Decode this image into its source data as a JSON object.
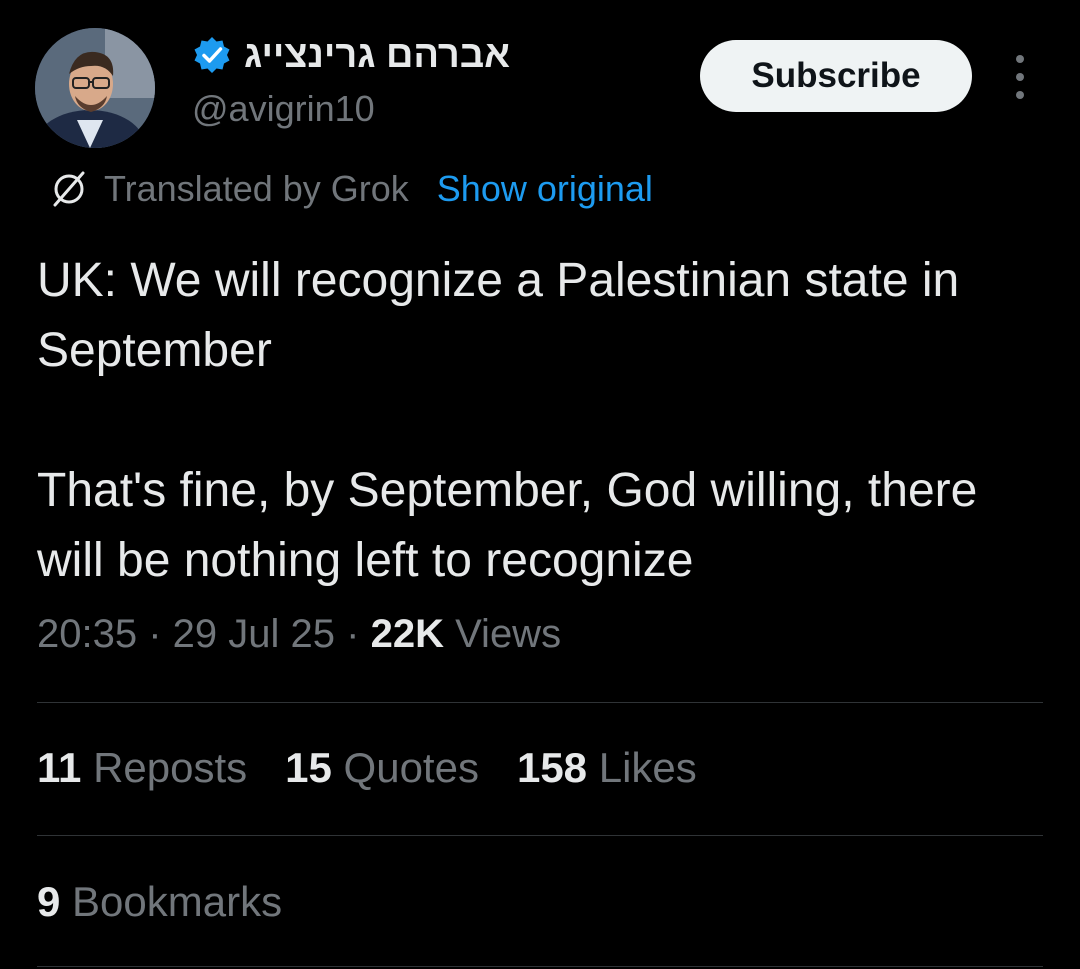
{
  "author": {
    "display_name": "אברהם גרינצייג",
    "handle": "@avigrin10",
    "verified_color": "#1d9bf0"
  },
  "actions": {
    "subscribe_label": "Subscribe",
    "more_icon": "more-vertical-icon"
  },
  "translation": {
    "icon": "translate-icon",
    "label": "Translated by Grok",
    "show_original": "Show original"
  },
  "tweet": {
    "paragraph1": "UK: We will recognize a Palestinian state in September",
    "paragraph2": "That's fine, by September, God willing, there will be nothing left to recognize"
  },
  "meta": {
    "time": "20:35",
    "date": "29 Jul 25",
    "views_count": "22K",
    "views_label": "Views"
  },
  "stats": {
    "reposts_count": "11",
    "reposts_label": "Reposts",
    "quotes_count": "15",
    "quotes_label": "Quotes",
    "likes_count": "158",
    "likes_label": "Likes",
    "bookmarks_count": "9",
    "bookmarks_label": "Bookmarks"
  }
}
